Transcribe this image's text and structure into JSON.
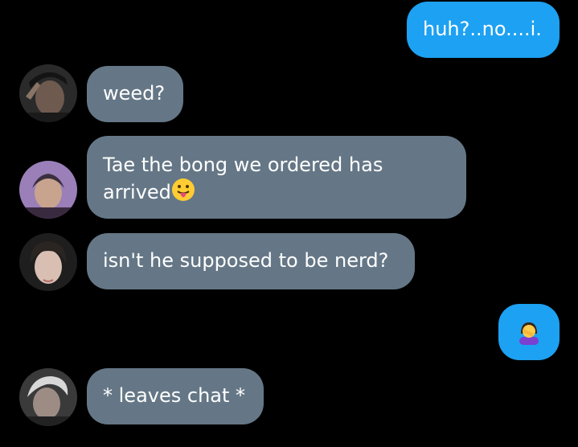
{
  "messages": [
    {
      "sender": "me",
      "text": "huh?..no....i."
    },
    {
      "sender": "other",
      "text": "weed?"
    },
    {
      "sender": "other",
      "text": "Tae the bong we ordered has",
      "text_line2": "arrived",
      "emoji": "face-with-tongue-emoji"
    },
    {
      "sender": "other",
      "text": "isn't he supposed to be  nerd?"
    },
    {
      "sender": "me",
      "emoji": "person-facepalming-emoji"
    },
    {
      "sender": "other",
      "text": "* leaves chat *"
    }
  ],
  "colors": {
    "background": "#000000",
    "outgoing_bubble": "#1da1f2",
    "incoming_bubble": "#657786",
    "text": "#ffffff"
  }
}
